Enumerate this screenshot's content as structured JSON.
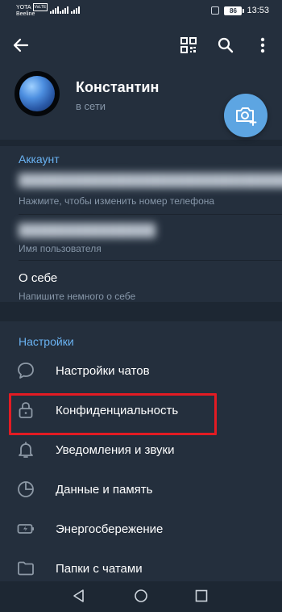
{
  "status_bar": {
    "carrier_1": "YOTA",
    "volte": "VoLTE",
    "carrier_2": "Beeline",
    "battery": "86",
    "time": "13:53"
  },
  "header": {
    "back_icon": "arrow-left-icon",
    "qr_icon": "qr-code-icon",
    "search_icon": "search-icon",
    "more_icon": "more-vertical-icon",
    "name": "Константин",
    "status": "в сети",
    "camera_icon": "camera-add-icon"
  },
  "account": {
    "title": "Аккаунт",
    "phone_hint": "Нажмите, чтобы изменить номер телефона",
    "username_label": "Имя пользователя",
    "about_title": "О себе",
    "about_hint": "Напишите немного о себе"
  },
  "settings": {
    "title": "Настройки",
    "items": [
      {
        "label": "Настройки чатов",
        "icon": "chat-bubble-icon"
      },
      {
        "label": "Конфиденциальность",
        "icon": "lock-icon"
      },
      {
        "label": "Уведомления и звуки",
        "icon": "bell-icon"
      },
      {
        "label": "Данные и память",
        "icon": "pie-chart-icon"
      },
      {
        "label": "Энергосбережение",
        "icon": "battery-icon"
      },
      {
        "label": "Папки с чатами",
        "icon": "folder-icon"
      }
    ]
  },
  "colors": {
    "background": "#1d2733",
    "surface": "#242f3d",
    "accent": "#6ab3f3",
    "fab": "#5da5e2",
    "highlight": "#e31b23"
  }
}
